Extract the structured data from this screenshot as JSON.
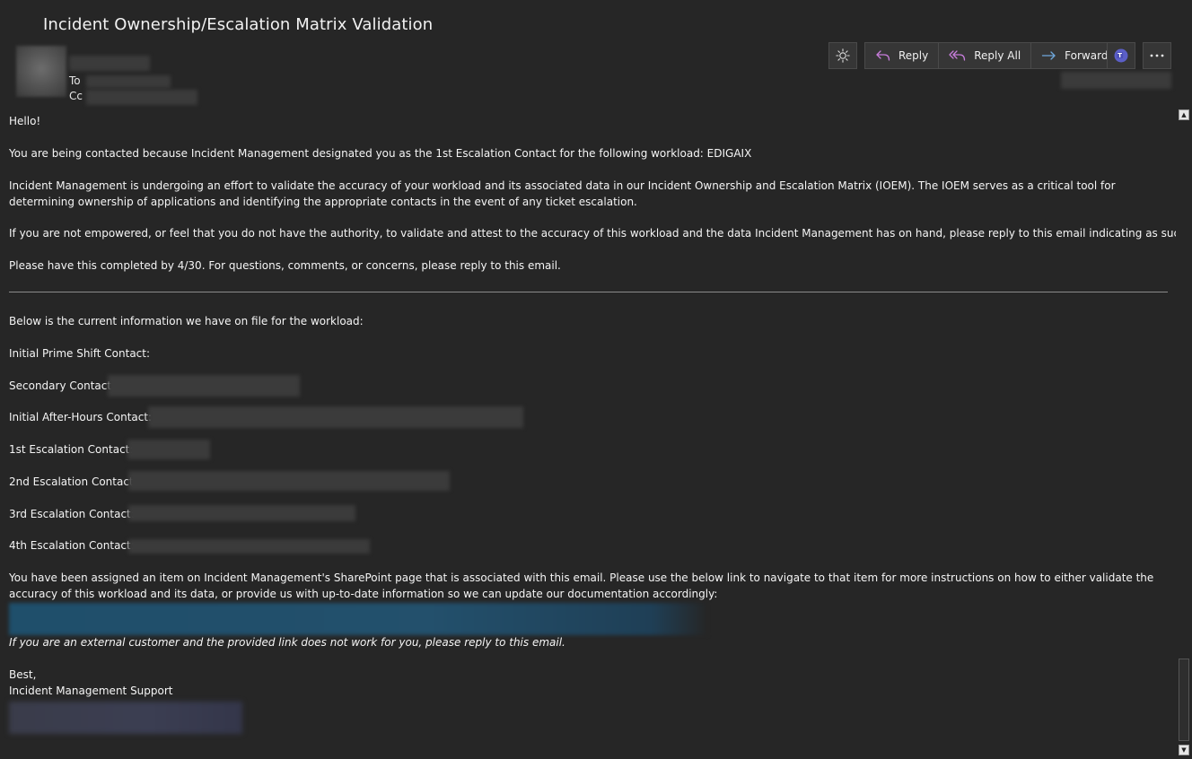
{
  "header": {
    "subject": "Incident Ownership/Escalation Matrix Validation",
    "to_label": "To",
    "cc_label": "Cc"
  },
  "toolbar": {
    "theme_icon": "sun-icon",
    "reply_label": "Reply",
    "reply_all_label": "Reply All",
    "forward_label": "Forward",
    "teams_icon": "teams-icon",
    "more_icon": "more-icon",
    "colors": {
      "reply": "#c77ddb",
      "forward": "#6fa8dc",
      "teams": "#5b5fc7"
    }
  },
  "body": {
    "greeting": "Hello!",
    "para1": "You are being contacted because Incident Management designated you as the 1st Escalation Contact for the following workload: EDIGAIX",
    "para2": "Incident Management is undergoing an effort to validate the accuracy of your workload and its associated data in our Incident Ownership and Escalation Matrix (IOEM). The IOEM serves as a critical tool for determining ownership of applications and identifying the appropriate contacts in the event of any ticket escalation.",
    "para3": "If you are not empowered, or feel that you do not have the authority, to validate and attest to the accuracy of this workload and the data Incident Management has on hand, please reply to this email indicating as such.",
    "para4": "Please have this completed by 4/30. For questions, comments, or concerns, please reply to this email.",
    "info_intro": "Below is the current information we have on file for the workload:",
    "contacts": {
      "prime": "Initial Prime Shift Contact:",
      "secondary": "Secondary Contact:",
      "after_hours": "Initial After-Hours Contact:",
      "esc1": "1st Escalation Contact:",
      "esc2": "2nd Escalation Contact:",
      "esc3": "3rd Escalation Contact:",
      "esc4": "4th Escalation Contact:"
    },
    "para5": "You have been assigned an item on Incident Management's SharePoint page that is associated with this email. Please use the below link to navigate to that item for more instructions on how to either validate the accuracy of this workload and its data, or provide us with up-to-date information so we can update our documentation accordingly:",
    "external_note": "If you are an external customer and the provided link does not work for you, please reply to this email.",
    "signoff": "Best,",
    "signature": "Incident Management Support"
  },
  "scrollbar": {
    "up_icon": "arrow-up-icon",
    "down_icon": "arrow-down-icon"
  }
}
